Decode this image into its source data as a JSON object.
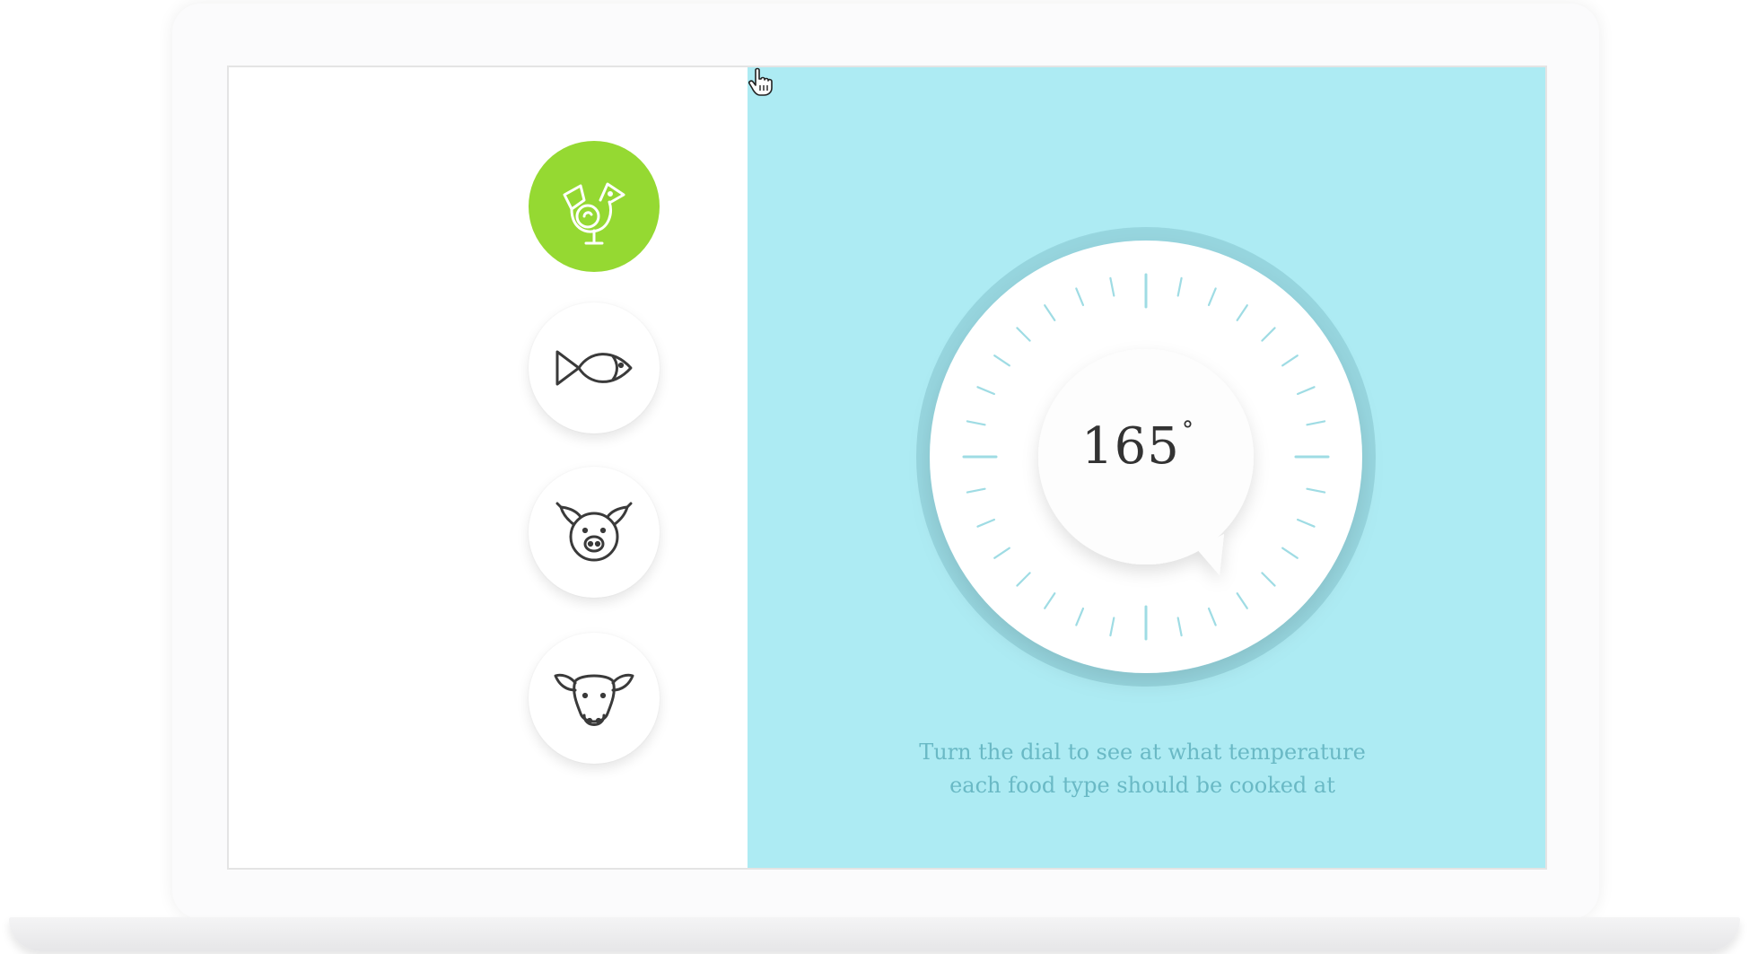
{
  "foods": [
    {
      "name": "chicken",
      "icon": "chicken-icon",
      "active": true
    },
    {
      "name": "fish",
      "icon": "fish-icon",
      "active": false
    },
    {
      "name": "pig",
      "icon": "pig-icon",
      "active": false
    },
    {
      "name": "cow",
      "icon": "cow-icon",
      "active": false
    }
  ],
  "dial": {
    "value": "165",
    "unit": "°"
  },
  "caption": {
    "line1": "Turn the dial to see at what temperature",
    "line2": "each food type should be cooked at"
  },
  "colors": {
    "active": "#95d932",
    "panel": "#adebf3",
    "tick": "#9fdce4",
    "caption": "#6ab9c5"
  }
}
